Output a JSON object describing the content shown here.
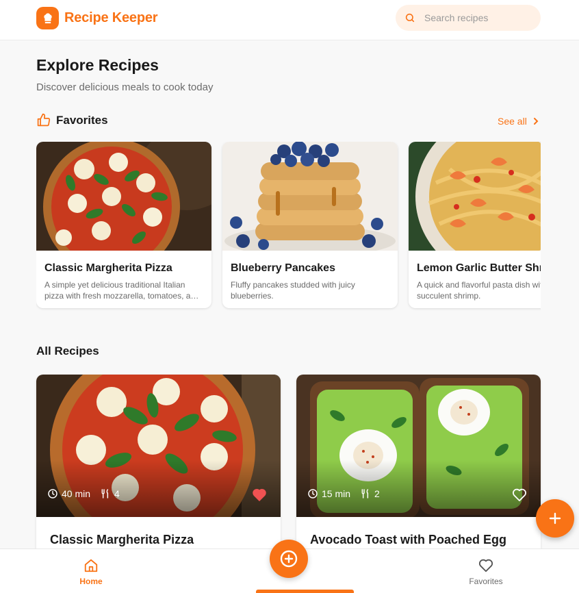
{
  "app": {
    "name": "Recipe Keeper",
    "accent": "#f97316"
  },
  "search": {
    "placeholder": "Search recipes",
    "value": ""
  },
  "page": {
    "title": "Explore Recipes",
    "subtitle": "Discover delicious meals to cook today"
  },
  "favorites": {
    "heading": "Favorites",
    "see_all": "See all",
    "items": [
      {
        "name": "Classic Margherita Pizza",
        "description": "A simple yet delicious traditional Italian pizza with fresh mozzarella, tomatoes, and basil."
      },
      {
        "name": "Blueberry Pancakes",
        "description": "Fluffy pancakes studded with juicy blueberries."
      },
      {
        "name": "Lemon Garlic Butter Shrimp",
        "description": "A quick and flavorful pasta dish with succulent shrimp."
      }
    ]
  },
  "all_recipes": {
    "heading": "All Recipes",
    "items": [
      {
        "name": "Classic Margherita Pizza",
        "time": "40 min",
        "servings": "4",
        "favorite": true
      },
      {
        "name": "Avocado Toast with Poached Egg",
        "time": "15 min",
        "servings": "2",
        "favorite": false
      }
    ]
  },
  "nav": {
    "home": "Home",
    "favorites": "Favorites"
  },
  "icons": {
    "logo": "chef-hat-icon",
    "search": "search-icon",
    "favorites": "thumbs-up-icon",
    "see_all": "chevron-right-icon",
    "time": "clock-icon",
    "servings": "utensils-icon",
    "favorite": "heart-icon",
    "add": "plus-icon",
    "home": "home-icon"
  }
}
